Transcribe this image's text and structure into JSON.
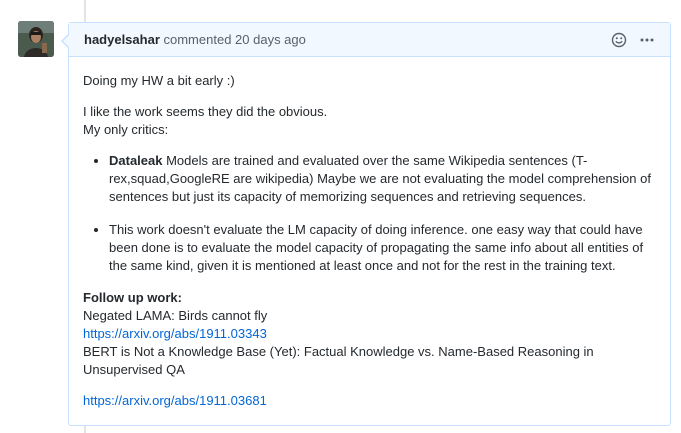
{
  "comment": {
    "author": "hadyelsahar",
    "meta": "commented 20 days ago",
    "icons": [
      "smiley-icon",
      "kebab-menu-icon"
    ],
    "body": {
      "intro": "Doing my HW a bit early :)",
      "line1": "I like the work seems they did the obvious.",
      "line2": "My only critics:",
      "bullets": [
        {
          "bold": "Dataleak",
          "text": " Models are trained and evaluated over the same Wikipedia sentences (T-rex,squad,GoogleRE are wikipedia) Maybe we are not evaluating the model comprehension of sentences but just its capacity of memorizing sequences and retrieving sequences."
        },
        {
          "bold": "",
          "text": "This work doesn't evaluate the LM capacity of doing inference. one easy way that could have been done is to evaluate the model capacity of propagating the same info about all entities of the same kind, given it is mentioned at least once and not for the rest in the training text."
        }
      ],
      "followup_heading": "Follow up work:",
      "ref1_title": "Negated LAMA: Birds cannot fly",
      "ref1_link": "https://arxiv.org/abs/1911.03343",
      "ref2_title": "BERT is Not a Knowledge Base (Yet): Factual Knowledge vs. Name-Based Reasoning in Unsupervised QA",
      "ref2_link": "https://arxiv.org/abs/1911.03681"
    }
  },
  "colors": {
    "header_bg": "#f1f8ff",
    "border": "#c8e1ff",
    "link": "#0366d6"
  }
}
